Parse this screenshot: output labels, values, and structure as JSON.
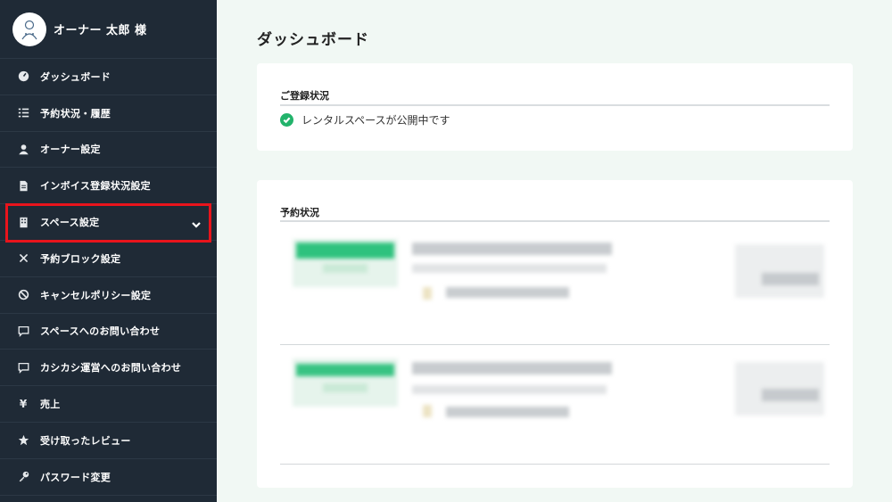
{
  "user": {
    "name": "オーナー 太郎 様"
  },
  "nav": [
    {
      "icon": "dashboard-icon",
      "label": "ダッシュボード"
    },
    {
      "icon": "list-check-icon",
      "label": "予約状況・履歴"
    },
    {
      "icon": "user-icon",
      "label": "オーナー設定"
    },
    {
      "icon": "document-icon",
      "label": "インボイス登録状況設定"
    },
    {
      "icon": "building-icon",
      "label": "スペース設定",
      "expandable": true,
      "highlighted": true
    },
    {
      "icon": "x-icon",
      "label": "予約ブロック設定"
    },
    {
      "icon": "ban-icon",
      "label": "キャンセルポリシー設定"
    },
    {
      "icon": "chat-icon",
      "label": "スペースへのお問い合わせ"
    },
    {
      "icon": "chat-icon",
      "label": "カシカシ運営へのお問い合わせ"
    },
    {
      "icon": "yen-icon",
      "label": "売上"
    },
    {
      "icon": "star-icon",
      "label": "受け取ったレビュー"
    },
    {
      "icon": "key-icon",
      "label": "パスワード変更"
    }
  ],
  "main": {
    "title": "ダッシュボード",
    "registration": {
      "heading": "ご登録状況",
      "status_text": "レンタルスペースが公開中です"
    },
    "reservations": {
      "heading": "予約状況"
    }
  },
  "colors": {
    "sidebar_bg": "#1f2a36",
    "accent_green": "#22b36b",
    "highlight_red": "#e8141c",
    "page_bg": "#f1f8f4"
  }
}
